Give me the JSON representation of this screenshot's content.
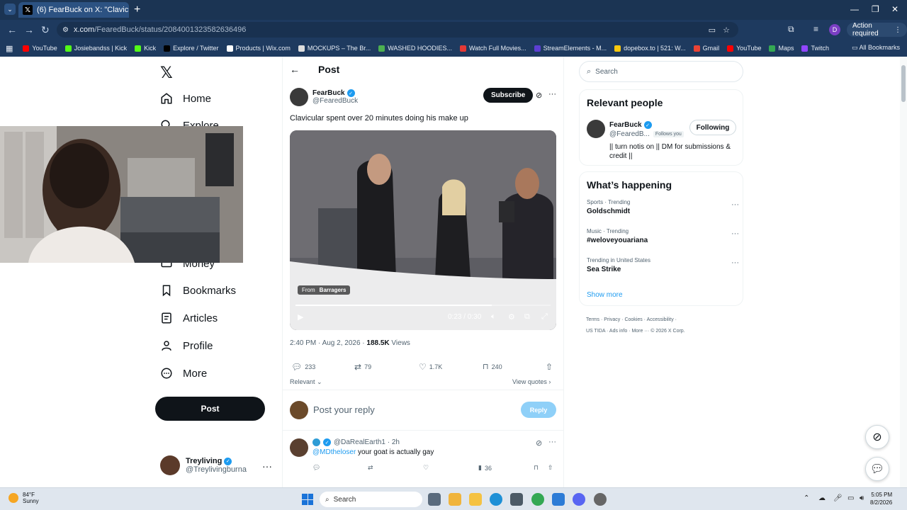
{
  "browser": {
    "tab_title": "(6) FearBuck on X: \"Clavicular s",
    "url_host": "x.com",
    "url_path": "/FearedBuck/status/2084001323582636496",
    "profile_initial": "D",
    "action_required": "Action required",
    "bookmarks": [
      {
        "label": "YouTube",
        "color": "#ff0000"
      },
      {
        "label": "Josiebandss | Kick",
        "color": "#53fc18"
      },
      {
        "label": "Kick",
        "color": "#53fc18"
      },
      {
        "label": "Explore / Twitter",
        "color": "#000000"
      },
      {
        "label": "Products | Wix.com",
        "color": "#ffffff"
      },
      {
        "label": "MOCKUPS – The Br...",
        "color": "#dddddd"
      },
      {
        "label": "WASHED HOODIES...",
        "color": "#4caf50"
      },
      {
        "label": "Watch Full Movies...",
        "color": "#e53935"
      },
      {
        "label": "StreamElements - M...",
        "color": "#5d3fd3"
      },
      {
        "label": "dopebox.to | 521: W...",
        "color": "#f9c80e"
      },
      {
        "label": "Gmail",
        "color": "#ea4335"
      },
      {
        "label": "YouTube",
        "color": "#ff0000"
      },
      {
        "label": "Maps",
        "color": "#34a853"
      },
      {
        "label": "Twitch",
        "color": "#9146ff"
      }
    ],
    "all_bookmarks": "All Bookmarks"
  },
  "leftnav": {
    "items": [
      {
        "label": "Home",
        "icon": "home-icon"
      },
      {
        "label": "Explore",
        "icon": "search-icon"
      },
      {
        "label": "Money",
        "icon": "money-icon"
      },
      {
        "label": "Bookmarks",
        "icon": "bookmark-icon"
      },
      {
        "label": "Articles",
        "icon": "article-icon"
      },
      {
        "label": "Profile",
        "icon": "profile-icon"
      },
      {
        "label": "More",
        "icon": "more-icon"
      }
    ],
    "post_button": "Post",
    "me": {
      "name": "Treyliving",
      "handle": "@Treylivingburna"
    }
  },
  "main": {
    "header_title": "Post",
    "author": {
      "name": "FearBuck",
      "handle": "@FearedBuck"
    },
    "subscribe": "Subscribe",
    "text": "Clavicular spent over 20 minutes doing his make up",
    "video": {
      "from_label": "From",
      "from_source": "Barragers",
      "time": "0:23 / 0:30",
      "progress": 0.77
    },
    "meta_time": "2:40 PM · Aug 2, 2026 · ",
    "meta_views": "188.5K",
    "meta_views_label": " Views",
    "counts": {
      "replies": "233",
      "reposts": "79",
      "likes": "1.7K",
      "bookmarks": "240"
    },
    "relevant": "Relevant",
    "view_quotes": "View quotes",
    "reply_placeholder": "Post your reply",
    "reply_button": "Reply",
    "reply": {
      "handle_time": "@DaRealEarth1 · 2h",
      "mention": "@MDtheloser",
      "text": " your goat is actually gay",
      "views": "36"
    }
  },
  "right": {
    "search_placeholder": "Search",
    "relevant_title": "Relevant people",
    "person": {
      "name": "FearBuck",
      "handle": "@FearedB...",
      "follows_you": "Follows you",
      "follow_button": "Following",
      "bio": "|| turn notis on || DM for submissions & credit ||"
    },
    "happening_title": "What’s happening",
    "trends": [
      {
        "context": "Sports · Trending",
        "name": "Goldschmidt"
      },
      {
        "context": "Music · Trending",
        "name": "#weloveyouariana"
      },
      {
        "context": "Trending in United States",
        "name": "Sea Strike"
      }
    ],
    "show_more": "Show more",
    "footer_line1": "Terms · Privacy · Cookies · Accessibility ·",
    "footer_line2": "US TIDA · Ads info · More ··· © 2026 X Corp."
  },
  "taskbar": {
    "temp": "84°F",
    "condition": "Sunny",
    "search": "Search",
    "time": "5:05 PM",
    "date": "8/2/2026"
  }
}
